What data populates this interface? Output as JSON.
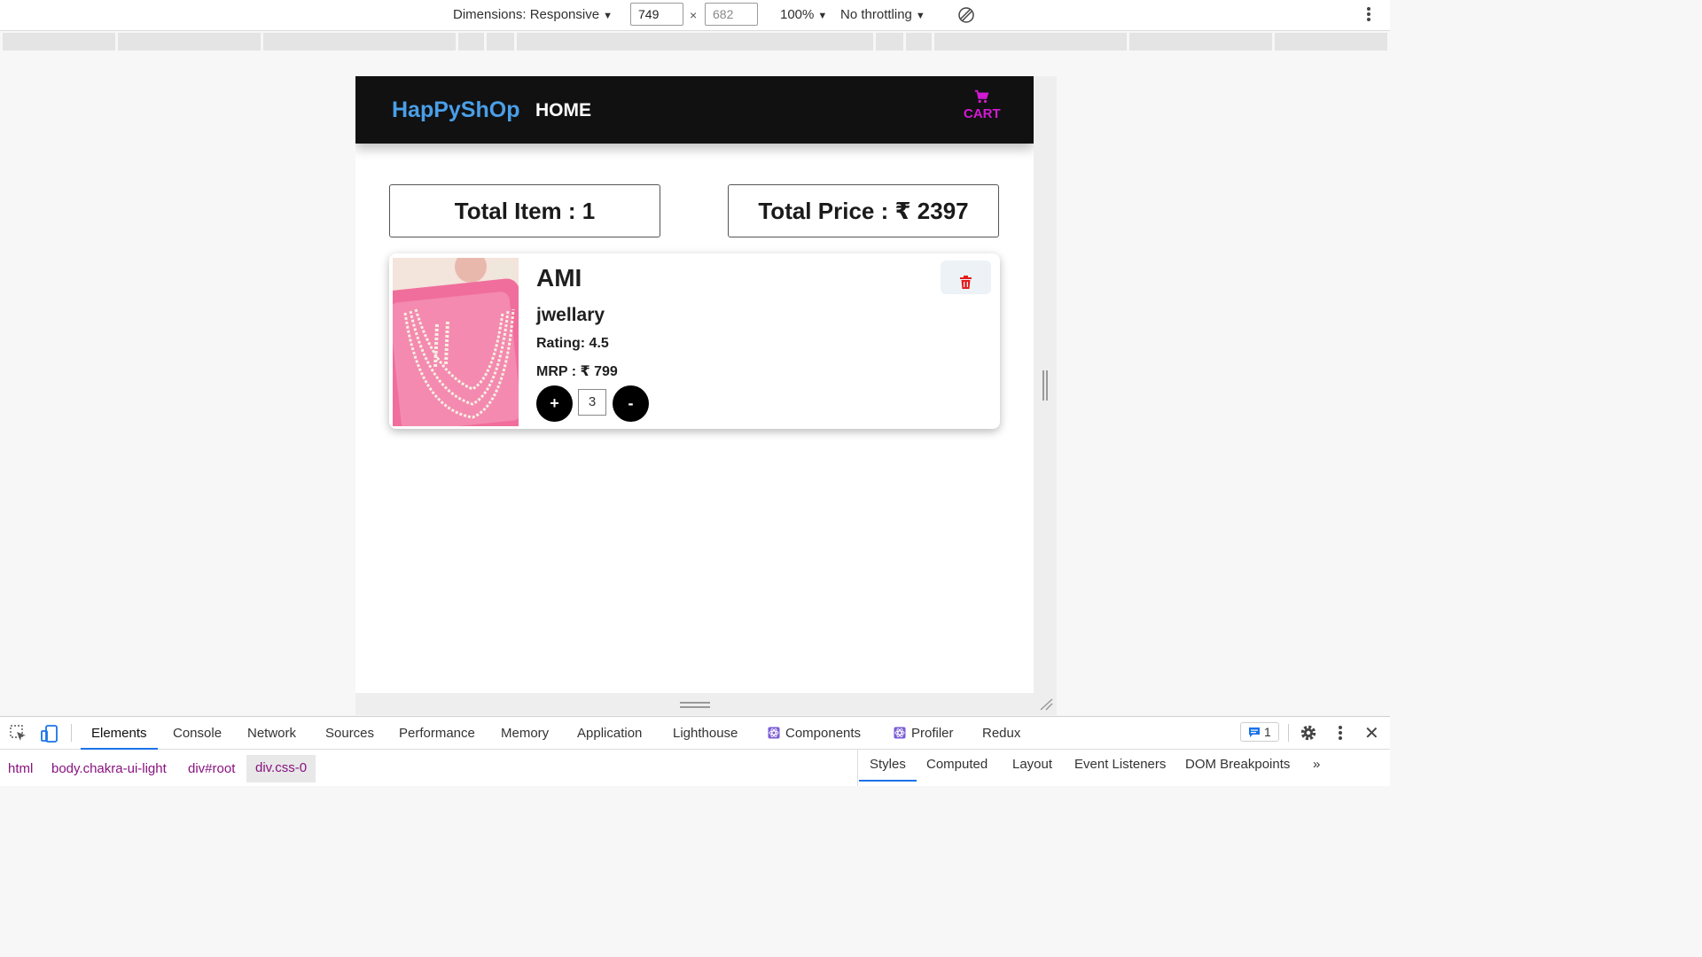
{
  "device_toolbar": {
    "dimensions_label": "Dimensions: Responsive",
    "width_value": "749",
    "height_value": "682",
    "times": "×",
    "zoom": "100%",
    "throttling": "No throttling"
  },
  "site": {
    "brand": "HapPyShOp",
    "nav_home": "HOME",
    "cart_label": "CART",
    "accent_color": "#d41ad4",
    "brand_color": "#4a9fe8"
  },
  "summary": {
    "total_items": "Total Item : 1",
    "total_price": "Total Price : ₹ 2397"
  },
  "cart_item": {
    "title": "AMI",
    "category": "jwellary",
    "rating": "Rating: 4.5",
    "mrp": "MRP : ₹ 799",
    "quantity": "3",
    "plus_label": "+",
    "minus_label": "-",
    "image_icon": "necklace-on-pink-tray",
    "delete_icon": "trash-icon"
  },
  "devtools": {
    "tabs": [
      "Elements",
      "Console",
      "Network",
      "Sources",
      "Performance",
      "Memory",
      "Application",
      "Lighthouse",
      "Components",
      "Profiler",
      "Redux"
    ],
    "issues_count": "1",
    "breadcrumbs": [
      "html",
      "body.chakra-ui-light",
      "div#root",
      "div.css-0"
    ],
    "side_tabs": [
      "Styles",
      "Computed",
      "Layout",
      "Event Listeners",
      "DOM Breakpoints"
    ],
    "more": "»"
  }
}
